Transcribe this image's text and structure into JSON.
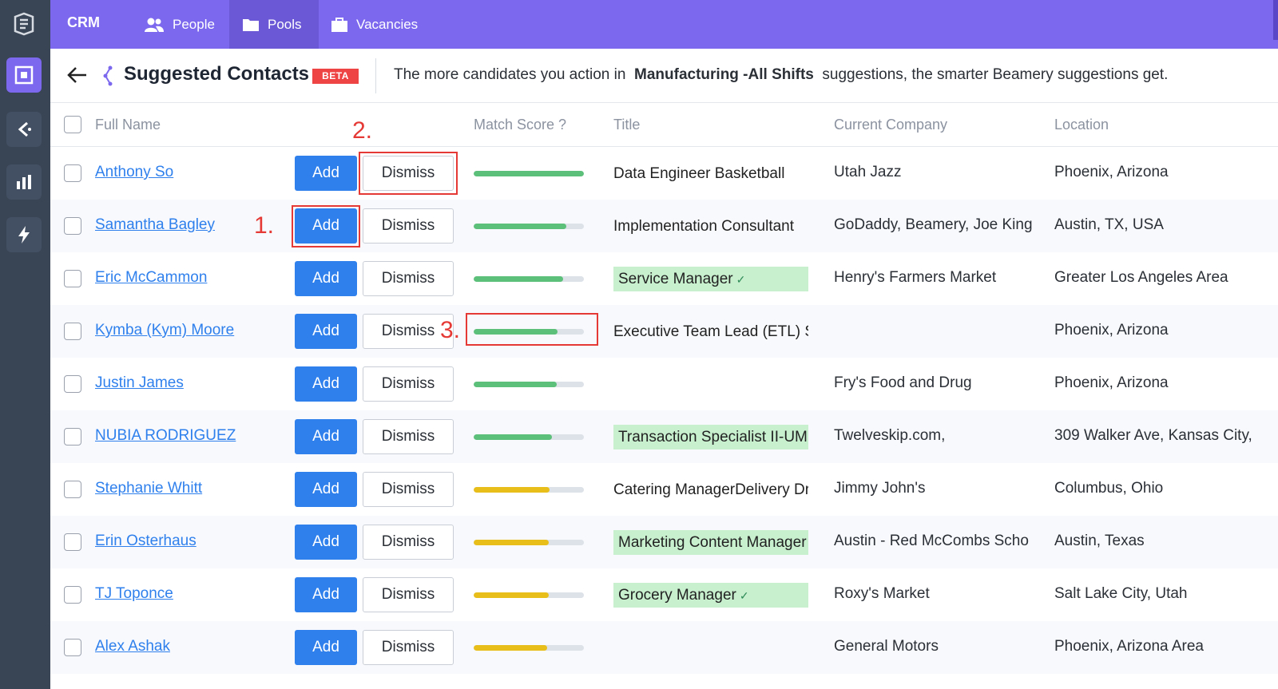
{
  "nav": {
    "brand": "CRM",
    "tabs": [
      {
        "label": "People",
        "icon": "people-icon"
      },
      {
        "label": "Pools",
        "icon": "folder-icon"
      },
      {
        "label": "Vacancies",
        "icon": "briefcase-icon"
      }
    ],
    "active_tab": "Pools"
  },
  "header": {
    "title": "Suggested Contacts",
    "badge": "BETA",
    "hint_prefix": "The more candidates you action in",
    "hint_pool": "Manufacturing -All Shifts",
    "hint_suffix": "suggestions, the smarter Beamery suggestions get."
  },
  "columns": {
    "full_name": "Full Name",
    "match_score": "Match Score ?",
    "title": "Title",
    "company": "Current Company",
    "location": "Location"
  },
  "buttons": {
    "add": "Add",
    "dismiss": "Dismiss"
  },
  "colors": {
    "high_score": "#5cbf7a",
    "mid_score": "#e8bf1a",
    "accent": "#7b68ee",
    "primary": "#2f80ed"
  },
  "rows": [
    {
      "name": "Anthony So",
      "score": 1.0,
      "tier": "high",
      "title": "Data Engineer Basketball",
      "title_verified": false,
      "company": "Utah Jazz",
      "location": "Phoenix, Arizona"
    },
    {
      "name": "Samantha Bagley",
      "score": 0.84,
      "tier": "high",
      "title": "Implementation Consultant",
      "title_verified": false,
      "company": "GoDaddy, Beamery, Joe King",
      "location": "Austin, TX, USA"
    },
    {
      "name": "Eric McCammon",
      "score": 0.81,
      "tier": "high",
      "title": "Service Manager",
      "title_verified": true,
      "company": "Henry's Farmers Market",
      "location": "Greater Los Angeles Area"
    },
    {
      "name": "Kymba (Kym) Moore",
      "score": 0.76,
      "tier": "high",
      "title": "Executive Team Lead (ETL) S",
      "title_verified": false,
      "company": "",
      "location": "Phoenix, Arizona"
    },
    {
      "name": "Justin James",
      "score": 0.75,
      "tier": "high",
      "title": "",
      "title_verified": false,
      "company": "Fry's Food and Drug",
      "location": "Phoenix, Arizona"
    },
    {
      "name": "NUBIA RODRIGUEZ",
      "score": 0.71,
      "tier": "high",
      "title": "Transaction Specialist II-UM",
      "title_verified": true,
      "company": "Twelveskip.com,",
      "location": "309 Walker Ave, Kansas City,"
    },
    {
      "name": "Stephanie Whitt",
      "score": 0.69,
      "tier": "mid",
      "title": "Catering ManagerDelivery Dr",
      "title_verified": false,
      "company": "Jimmy John's",
      "location": "Columbus, Ohio"
    },
    {
      "name": "Erin Osterhaus",
      "score": 0.68,
      "tier": "mid",
      "title": "Marketing Content Manager",
      "title_verified": true,
      "company": "Austin - Red McCombs Scho",
      "location": "Austin, Texas"
    },
    {
      "name": "TJ Toponce",
      "score": 0.68,
      "tier": "mid",
      "title": "Grocery Manager",
      "title_verified": true,
      "company": "Roxy's Market",
      "location": "Salt Lake City, Utah"
    },
    {
      "name": "Alex Ashak",
      "score": 0.67,
      "tier": "mid",
      "title": "",
      "title_verified": false,
      "company": "General Motors",
      "location": "Phoenix, Arizona Area"
    }
  ],
  "annotations": {
    "one": "1.",
    "two": "2.",
    "three": "3."
  }
}
